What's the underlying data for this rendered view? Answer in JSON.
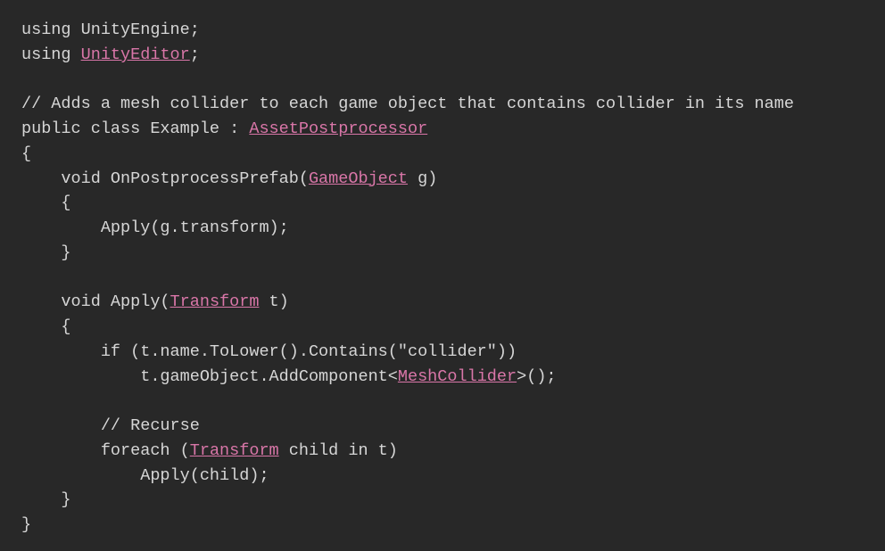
{
  "code": {
    "lines": [
      {
        "type": "mixed",
        "segments": [
          {
            "text": "using ",
            "class": "plain"
          },
          {
            "text": "UnityEngine",
            "class": "plain"
          },
          {
            "text": ";",
            "class": "plain"
          }
        ]
      },
      {
        "type": "mixed",
        "segments": [
          {
            "text": "using ",
            "class": "plain"
          },
          {
            "text": "UnityEditor",
            "class": "link"
          },
          {
            "text": ";",
            "class": "plain"
          }
        ]
      },
      {
        "type": "blank"
      },
      {
        "type": "mixed",
        "segments": [
          {
            "text": "// Adds a mesh collider to each game object that contains collider in its name",
            "class": "comment"
          }
        ]
      },
      {
        "type": "mixed",
        "segments": [
          {
            "text": "public class Example : ",
            "class": "plain"
          },
          {
            "text": "AssetPostprocessor",
            "class": "link"
          }
        ]
      },
      {
        "type": "mixed",
        "segments": [
          {
            "text": "{",
            "class": "plain"
          }
        ]
      },
      {
        "type": "mixed",
        "segments": [
          {
            "text": "    void OnPostprocessPrefab(",
            "class": "plain"
          },
          {
            "text": "GameObject",
            "class": "link"
          },
          {
            "text": " g)",
            "class": "plain"
          }
        ]
      },
      {
        "type": "mixed",
        "segments": [
          {
            "text": "    {",
            "class": "plain"
          }
        ]
      },
      {
        "type": "mixed",
        "segments": [
          {
            "text": "        Apply(g.transform);",
            "class": "plain"
          }
        ]
      },
      {
        "type": "mixed",
        "segments": [
          {
            "text": "    }",
            "class": "plain"
          }
        ]
      },
      {
        "type": "blank"
      },
      {
        "type": "mixed",
        "segments": [
          {
            "text": "    void Apply(",
            "class": "plain"
          },
          {
            "text": "Transform",
            "class": "link"
          },
          {
            "text": " t)",
            "class": "plain"
          }
        ]
      },
      {
        "type": "mixed",
        "segments": [
          {
            "text": "    {",
            "class": "plain"
          }
        ]
      },
      {
        "type": "mixed",
        "segments": [
          {
            "text": "        if (t.name.ToLower().Contains(\"collider\"))",
            "class": "plain"
          }
        ]
      },
      {
        "type": "mixed",
        "segments": [
          {
            "text": "            t.gameObject.AddComponent<",
            "class": "plain"
          },
          {
            "text": "MeshCollider",
            "class": "link"
          },
          {
            "text": ">();",
            "class": "plain"
          }
        ]
      },
      {
        "type": "blank"
      },
      {
        "type": "mixed",
        "segments": [
          {
            "text": "        // Recurse",
            "class": "comment"
          }
        ]
      },
      {
        "type": "mixed",
        "segments": [
          {
            "text": "        foreach (",
            "class": "plain"
          },
          {
            "text": "Transform",
            "class": "link"
          },
          {
            "text": " child in t)",
            "class": "plain"
          }
        ]
      },
      {
        "type": "mixed",
        "segments": [
          {
            "text": "            Apply(child);",
            "class": "plain"
          }
        ]
      },
      {
        "type": "mixed",
        "segments": [
          {
            "text": "    }",
            "class": "plain"
          }
        ]
      },
      {
        "type": "mixed",
        "segments": [
          {
            "text": "}",
            "class": "plain"
          }
        ]
      }
    ]
  }
}
